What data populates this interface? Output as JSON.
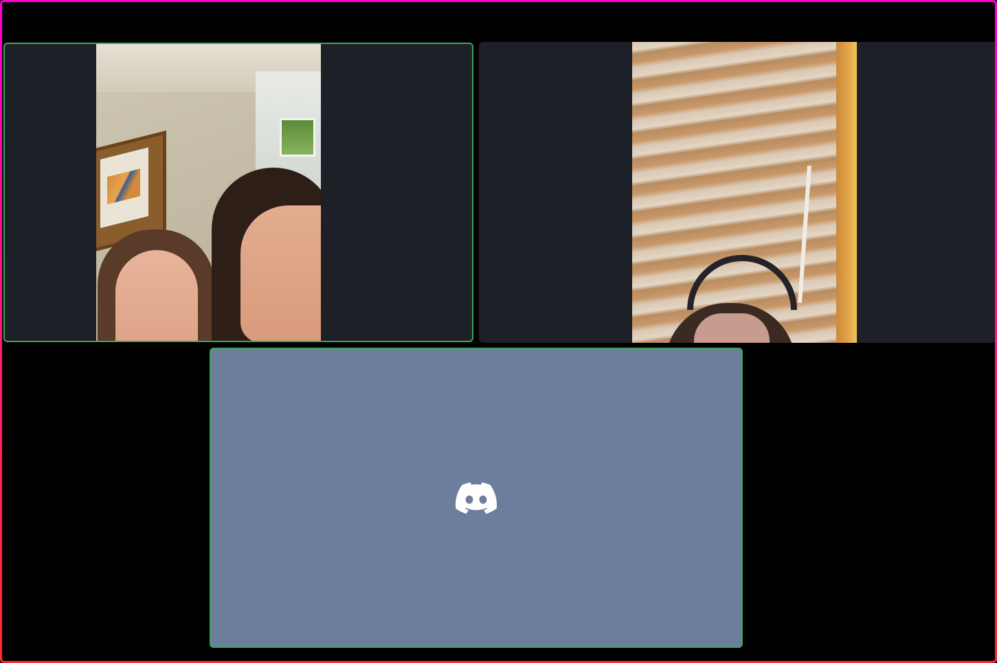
{
  "call": {
    "participants": [
      {
        "id": "participant-1",
        "state": "speaking",
        "media": "video"
      },
      {
        "id": "participant-2",
        "state": "idle",
        "media": "video"
      },
      {
        "id": "participant-3",
        "state": "speaking",
        "media": "avatar",
        "avatar_icon": "discord-logo-icon"
      }
    ]
  },
  "colors": {
    "frame_gradient": [
      "#ff00d4",
      "#ff2a2a"
    ],
    "speaking_ring": "#3ba55c",
    "tile_background": "#1e2028",
    "avatar_background": "#6c7e9c"
  }
}
